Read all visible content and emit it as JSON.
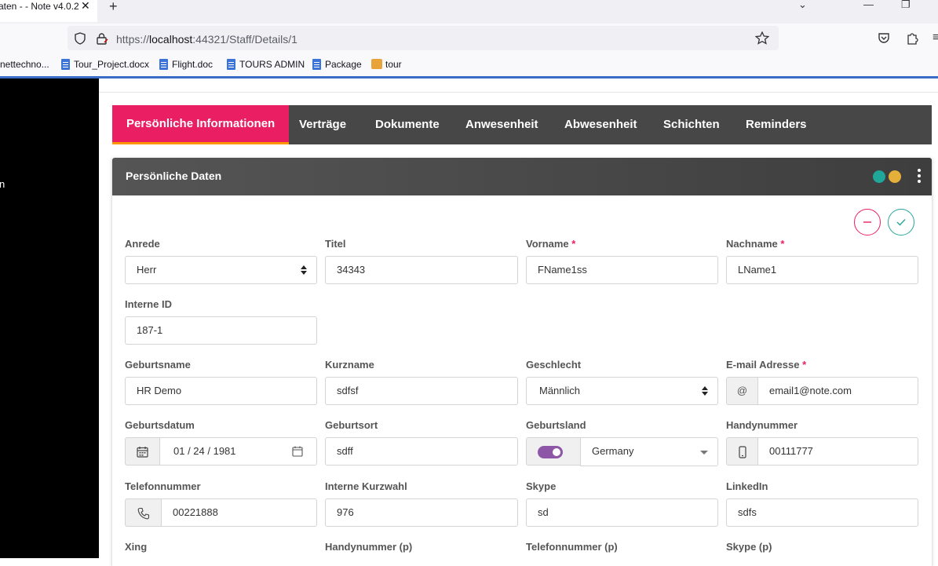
{
  "browser": {
    "tab_title": "aten - - Note v4.0.2",
    "tab_close": "✕",
    "new_tab": "+",
    "url_prefix": "https://",
    "url_host": "localhost",
    "url_rest": ":44321/Staff/Details/1",
    "bookmarks": [
      {
        "label": "nettechno...",
        "icon": ""
      },
      {
        "label": "Tour_Project.docx",
        "icon": "doc-icon"
      },
      {
        "label": "Flight.doc",
        "icon": "doc-icon"
      },
      {
        "label": "TOURS ADMIN",
        "icon": "doc-icon"
      },
      {
        "label": "Package",
        "icon": "doc-icon"
      },
      {
        "label": "tour",
        "icon": "app-icon"
      }
    ]
  },
  "sidebar": {
    "partial_text": "n"
  },
  "tabs": [
    {
      "label": "Persönliche Informationen",
      "active": true
    },
    {
      "label": "Verträge"
    },
    {
      "label": "Dokumente"
    },
    {
      "label": "Anwesenheit"
    },
    {
      "label": "Abwesenheit"
    },
    {
      "label": "Schichten"
    },
    {
      "label": "Reminders"
    }
  ],
  "card": {
    "title": "Persönliche Daten",
    "dot_colors": [
      "#1fa79a",
      "#e5b03a"
    ],
    "cancel_color": "#e91e63",
    "save_color": "#26a69a"
  },
  "form": {
    "anrede": {
      "label": "Anrede",
      "value": "Herr"
    },
    "titel": {
      "label": "Titel",
      "value": "34343"
    },
    "vorname": {
      "label": "Vorname",
      "required": "*",
      "value": "FName1ss"
    },
    "nachname": {
      "label": "Nachname",
      "required": "*",
      "value": "LName1"
    },
    "interne_id": {
      "label": "Interne ID",
      "value": "187-1"
    },
    "geburtsname": {
      "label": "Geburtsname",
      "value": "HR Demo"
    },
    "kurzname": {
      "label": "Kurzname",
      "value": "sdfsf"
    },
    "geschlecht": {
      "label": "Geschlecht",
      "value": "Männlich"
    },
    "email": {
      "label": "E-mail Adresse",
      "required": "*",
      "addon": "@",
      "value": "email1@note.com"
    },
    "geburtsdatum": {
      "label": "Geburtsdatum",
      "value": "01 / 24 / 1981"
    },
    "geburtsort": {
      "label": "Geburtsort",
      "value": "sdff"
    },
    "geburtsland": {
      "label": "Geburtsland",
      "value": "Germany"
    },
    "handynummer": {
      "label": "Handynummer",
      "value": "00111777"
    },
    "telefonnummer": {
      "label": "Telefonnummer",
      "value": "00221888"
    },
    "interne_kurzwahl": {
      "label": "Interne Kurzwahl",
      "value": "976"
    },
    "skype": {
      "label": "Skype",
      "value": "sd"
    },
    "linkedin": {
      "label": "LinkedIn",
      "value": "sdfs"
    },
    "xing": {
      "label": "Xing"
    },
    "handynummer_p": {
      "label": "Handynummer (p)"
    },
    "telefonnummer_p": {
      "label": "Telefonnummer (p)"
    },
    "skype_p": {
      "label": "Skype (p)"
    }
  }
}
